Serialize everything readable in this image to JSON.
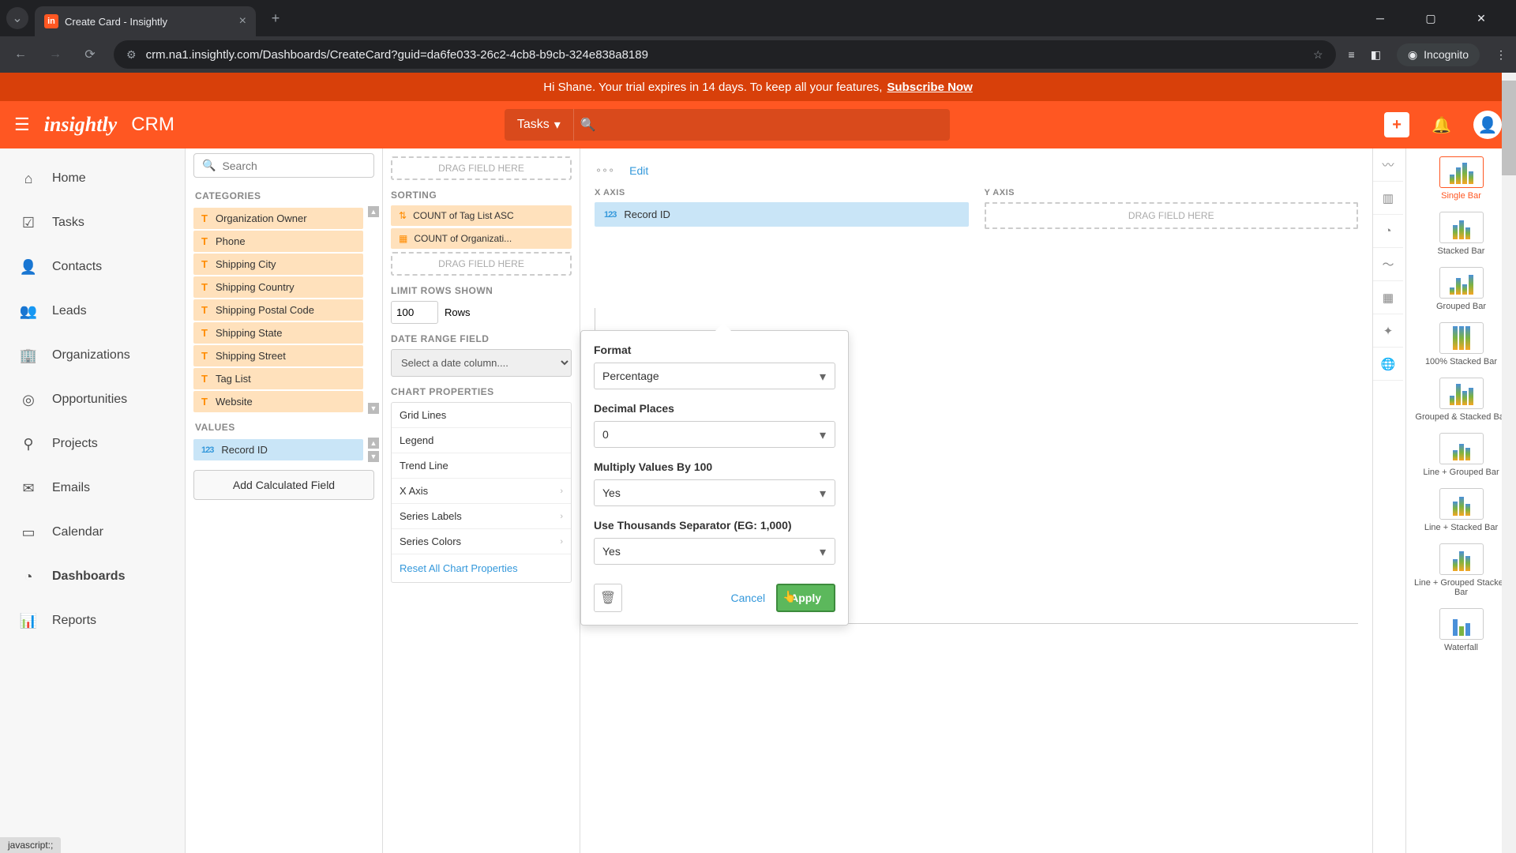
{
  "browser": {
    "tab_title": "Create Card - Insightly",
    "url": "crm.na1.insightly.com/Dashboards/CreateCard?guid=da6fe033-26c2-4cb8-b9cb-324e838a8189",
    "incognito_label": "Incognito",
    "status_text": "javascript:;"
  },
  "trial": {
    "greeting": "Hi Shane. Your trial expires in 14 days. To keep all your features,",
    "cta": "Subscribe Now"
  },
  "header": {
    "logo": "insightly",
    "crm": "CRM",
    "tasks_label": "Tasks"
  },
  "nav": {
    "items": [
      {
        "label": "Home",
        "icon": "⌂"
      },
      {
        "label": "Tasks",
        "icon": "✔"
      },
      {
        "label": "Contacts",
        "icon": "👤"
      },
      {
        "label": "Leads",
        "icon": "👥"
      },
      {
        "label": "Organizations",
        "icon": "🏢"
      },
      {
        "label": "Opportunities",
        "icon": "◎"
      },
      {
        "label": "Projects",
        "icon": "⟙"
      },
      {
        "label": "Emails",
        "icon": "✉"
      },
      {
        "label": "Calendar",
        "icon": "▭"
      },
      {
        "label": "Dashboards",
        "icon": "⏱"
      },
      {
        "label": "Reports",
        "icon": "📊"
      }
    ]
  },
  "fields": {
    "search_placeholder": "Search",
    "categories_label": "CATEGORIES",
    "values_label": "VALUES",
    "category_items": [
      "Organization Owner",
      "Phone",
      "Shipping City",
      "Shipping Country",
      "Shipping Postal Code",
      "Shipping State",
      "Shipping Street",
      "Tag List",
      "Website"
    ],
    "value_items": [
      "Record ID"
    ],
    "add_calc": "Add Calculated Field"
  },
  "config": {
    "drag_placeholder": "DRAG FIELD HERE",
    "sorting_label": "SORTING",
    "sort_items": [
      "COUNT of Tag List ASC",
      "COUNT of Organizati..."
    ],
    "limit_label": "LIMIT ROWS SHOWN",
    "limit_value": "100",
    "rows_label": "Rows",
    "date_range_label": "DATE RANGE FIELD",
    "date_placeholder": "Select a date column....",
    "chart_props_label": "CHART PROPERTIES",
    "props": [
      "Grid Lines",
      "Legend",
      "Trend Line",
      "X Axis",
      "Series Labels",
      "Series Colors"
    ],
    "reset": "Reset All Chart Properties"
  },
  "chart": {
    "edit_label": "Edit",
    "x_axis_label": "X AXIS",
    "y_axis_label": "Y AXIS",
    "x_chip": "Record ID"
  },
  "popover": {
    "format_label": "Format",
    "format_value": "Percentage",
    "decimal_label": "Decimal Places",
    "decimal_value": "0",
    "multiply_label": "Multiply Values By 100",
    "multiply_value": "Yes",
    "thousands_label": "Use Thousands Separator (EG: 1,000)",
    "thousands_value": "Yes",
    "cancel": "Cancel",
    "apply": "Apply"
  },
  "chart_types": {
    "items": [
      "Single Bar",
      "Stacked Bar",
      "Grouped Bar",
      "100% Stacked Bar",
      "Grouped & Stacked Bar",
      "Line + Grouped Bar",
      "Line + Stacked Bar",
      "Line + Grouped Stacked Bar",
      "Waterfall"
    ]
  }
}
